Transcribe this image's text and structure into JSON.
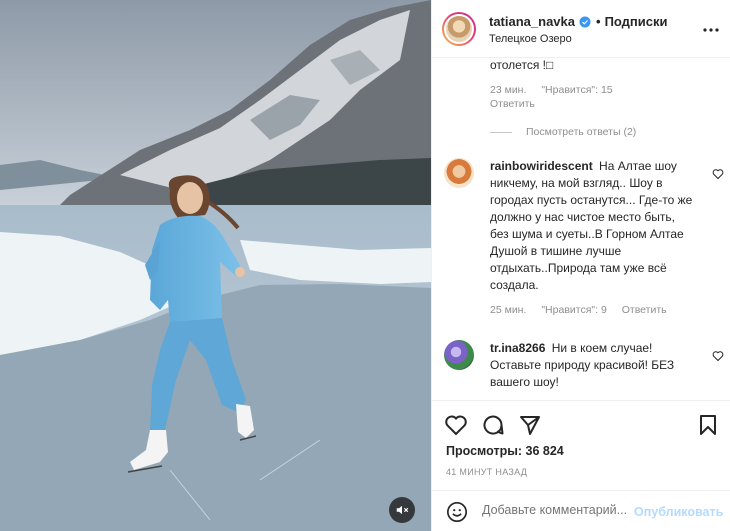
{
  "header": {
    "username": "tatiana_navka",
    "separator": "•",
    "follow_label": "Подписки",
    "location": "Телецкое Озеро",
    "verified_icon": "verified-badge-icon",
    "more_icon": "more-horizontal-icon"
  },
  "comments": {
    "fragment_text": "отолется !□",
    "first_meta": {
      "time": "23 мин.",
      "likes": "\"Нравится\": 15",
      "reply": "Ответить"
    },
    "view_replies": "Посмотреть ответы (2)",
    "items": [
      {
        "username": "rainbowiridescent",
        "text": "На Алтае шоу никчему, на мой взгляд.. Шоу в городах пусть останутся... Где-то же должно у нас чистое место быть, без шума и суеты..В Горном Алтае Душой в тишине лучше отдыхать..Природа там уже всё создала.",
        "time": "25 мин.",
        "likes": "\"Нравится\": 9",
        "reply": "Ответить"
      },
      {
        "username": "tr.ina8266",
        "text": "Ни в коем случае! Оставьте природу красивой! БЕЗ вашего шоу!"
      }
    ]
  },
  "actions": {
    "like_icon": "heart-icon",
    "comment_icon": "comment-icon",
    "share_icon": "send-icon",
    "save_icon": "bookmark-icon"
  },
  "stats": {
    "views": "Просмотры: 36 824",
    "timestamp": "41 МИНУТ НАЗАД"
  },
  "composer": {
    "placeholder": "Добавьте комментарий...",
    "publish_label": "Опубликовать",
    "emoji_icon": "emoji-icon"
  },
  "media": {
    "mute_icon": "speaker-mute-icon"
  },
  "colors": {
    "accent": "#0095f6",
    "publish_disabled": "#b3dbff",
    "muted_text": "#8e8e8e",
    "verified": "#3897f0"
  }
}
